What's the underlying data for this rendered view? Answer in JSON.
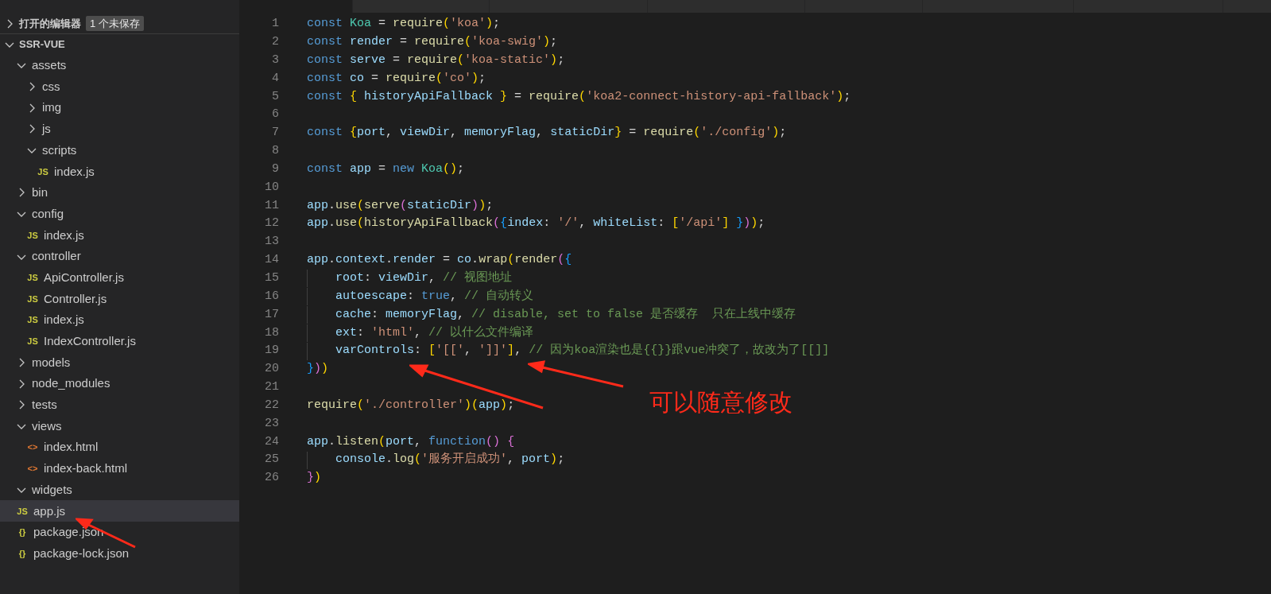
{
  "tabs": [
    {
      "selected": true
    },
    {
      "selected": false
    },
    {
      "selected": false
    },
    {
      "selected": false
    },
    {
      "selected": false
    },
    {
      "selected": false
    },
    {
      "selected": false
    },
    {
      "selected": false
    }
  ],
  "explorer": {
    "open_editors": {
      "label": "打开的编辑器",
      "badge": "1 个未保存",
      "expanded": false
    },
    "root": {
      "label": "SSR-VUE",
      "expanded": true,
      "selected": false,
      "children": [
        {
          "kind": "folder",
          "label": "assets",
          "expanded": true,
          "selected": false,
          "children": [
            {
              "kind": "folder",
              "label": "css",
              "expanded": false,
              "selected": false
            },
            {
              "kind": "folder",
              "label": "img",
              "expanded": false,
              "selected": false
            },
            {
              "kind": "folder",
              "label": "js",
              "expanded": false,
              "selected": false
            },
            {
              "kind": "folder",
              "label": "scripts",
              "expanded": true,
              "selected": false,
              "children": [
                {
                  "kind": "js",
                  "icon": "JS",
                  "label": "index.js",
                  "selected": false
                }
              ]
            }
          ]
        },
        {
          "kind": "folder",
          "label": "bin",
          "expanded": false,
          "selected": false
        },
        {
          "kind": "folder",
          "label": "config",
          "expanded": true,
          "selected": false,
          "children": [
            {
              "kind": "js",
              "icon": "JS",
              "label": "index.js",
              "selected": false
            }
          ]
        },
        {
          "kind": "folder",
          "label": "controller",
          "expanded": true,
          "selected": false,
          "children": [
            {
              "kind": "js",
              "icon": "JS",
              "label": "ApiController.js",
              "selected": false
            },
            {
              "kind": "js",
              "icon": "JS",
              "label": "Controller.js",
              "selected": false
            },
            {
              "kind": "js",
              "icon": "JS",
              "label": "index.js",
              "selected": false
            },
            {
              "kind": "js",
              "icon": "JS",
              "label": "IndexController.js",
              "selected": false
            }
          ]
        },
        {
          "kind": "folder",
          "label": "models",
          "expanded": false,
          "selected": false
        },
        {
          "kind": "folder",
          "label": "node_modules",
          "expanded": false,
          "selected": false
        },
        {
          "kind": "folder",
          "label": "tests",
          "expanded": false,
          "selected": false
        },
        {
          "kind": "folder",
          "label": "views",
          "expanded": true,
          "selected": false,
          "children": [
            {
              "kind": "html",
              "icon": "<>",
              "label": "index.html",
              "selected": false
            },
            {
              "kind": "html",
              "icon": "<>",
              "label": "index-back.html",
              "selected": false
            }
          ]
        },
        {
          "kind": "folder",
          "label": "widgets",
          "expanded": true,
          "selected": false
        },
        {
          "kind": "js",
          "icon": "JS",
          "label": "app.js",
          "selected": true
        },
        {
          "kind": "json",
          "icon": "{}",
          "label": "package.json",
          "selected": false
        },
        {
          "kind": "json",
          "icon": "{}",
          "label": "package-lock.json",
          "selected": false
        }
      ]
    }
  },
  "code": [
    {
      "number": "1",
      "tokens": [
        {
          "kind": "keyword",
          "text": "const "
        },
        {
          "kind": "class",
          "text": "Koa"
        },
        {
          "kind": "plain",
          "text": " = "
        },
        {
          "kind": "function",
          "text": "require"
        },
        {
          "kind": "bracket1",
          "text": "("
        },
        {
          "kind": "string",
          "text": "'koa'"
        },
        {
          "kind": "bracket1",
          "text": ")"
        },
        {
          "kind": "plain",
          "text": ";"
        }
      ]
    },
    {
      "number": "2",
      "tokens": [
        {
          "kind": "keyword",
          "text": "const "
        },
        {
          "kind": "variable",
          "text": "render"
        },
        {
          "kind": "plain",
          "text": " = "
        },
        {
          "kind": "function",
          "text": "require"
        },
        {
          "kind": "bracket1",
          "text": "("
        },
        {
          "kind": "string",
          "text": "'koa-swig'"
        },
        {
          "kind": "bracket1",
          "text": ")"
        },
        {
          "kind": "plain",
          "text": ";"
        }
      ]
    },
    {
      "number": "3",
      "tokens": [
        {
          "kind": "keyword",
          "text": "const "
        },
        {
          "kind": "variable",
          "text": "serve"
        },
        {
          "kind": "plain",
          "text": " = "
        },
        {
          "kind": "function",
          "text": "require"
        },
        {
          "kind": "bracket1",
          "text": "("
        },
        {
          "kind": "string",
          "text": "'koa-static'"
        },
        {
          "kind": "bracket1",
          "text": ")"
        },
        {
          "kind": "plain",
          "text": ";"
        }
      ]
    },
    {
      "number": "4",
      "tokens": [
        {
          "kind": "keyword",
          "text": "const "
        },
        {
          "kind": "variable",
          "text": "co"
        },
        {
          "kind": "plain",
          "text": " = "
        },
        {
          "kind": "function",
          "text": "require"
        },
        {
          "kind": "bracket1",
          "text": "("
        },
        {
          "kind": "string",
          "text": "'co'"
        },
        {
          "kind": "bracket1",
          "text": ")"
        },
        {
          "kind": "plain",
          "text": ";"
        }
      ]
    },
    {
      "number": "5",
      "tokens": [
        {
          "kind": "keyword",
          "text": "const "
        },
        {
          "kind": "bracket1",
          "text": "{"
        },
        {
          "kind": "variable",
          "text": " historyApiFallback "
        },
        {
          "kind": "bracket1",
          "text": "}"
        },
        {
          "kind": "plain",
          "text": " = "
        },
        {
          "kind": "function",
          "text": "require"
        },
        {
          "kind": "bracket1",
          "text": "("
        },
        {
          "kind": "string",
          "text": "'koa2-connect-history-api-fallback'"
        },
        {
          "kind": "bracket1",
          "text": ")"
        },
        {
          "kind": "plain",
          "text": ";"
        }
      ]
    },
    {
      "number": "6"
    },
    {
      "number": "7",
      "tokens": [
        {
          "kind": "keyword",
          "text": "const "
        },
        {
          "kind": "bracket1",
          "text": "{"
        },
        {
          "kind": "variable",
          "text": "port"
        },
        {
          "kind": "plain",
          "text": ", "
        },
        {
          "kind": "variable",
          "text": "viewDir"
        },
        {
          "kind": "plain",
          "text": ", "
        },
        {
          "kind": "variable",
          "text": "memoryFlag"
        },
        {
          "kind": "plain",
          "text": ", "
        },
        {
          "kind": "variable",
          "text": "staticDir"
        },
        {
          "kind": "bracket1",
          "text": "}"
        },
        {
          "kind": "plain",
          "text": " = "
        },
        {
          "kind": "function",
          "text": "require"
        },
        {
          "kind": "bracket1",
          "text": "("
        },
        {
          "kind": "string",
          "text": "'./config'"
        },
        {
          "kind": "bracket1",
          "text": ")"
        },
        {
          "kind": "plain",
          "text": ";"
        }
      ]
    },
    {
      "number": "8"
    },
    {
      "number": "9",
      "tokens": [
        {
          "kind": "keyword",
          "text": "const "
        },
        {
          "kind": "variable",
          "text": "app"
        },
        {
          "kind": "plain",
          "text": " = "
        },
        {
          "kind": "keyword",
          "text": "new "
        },
        {
          "kind": "class",
          "text": "Koa"
        },
        {
          "kind": "bracket1",
          "text": "()"
        },
        {
          "kind": "plain",
          "text": ";"
        }
      ]
    },
    {
      "number": "10"
    },
    {
      "number": "11",
      "tokens": [
        {
          "kind": "variable",
          "text": "app"
        },
        {
          "kind": "plain",
          "text": "."
        },
        {
          "kind": "function",
          "text": "use"
        },
        {
          "kind": "bracket1",
          "text": "("
        },
        {
          "kind": "function",
          "text": "serve"
        },
        {
          "kind": "bracket2",
          "text": "("
        },
        {
          "kind": "variable",
          "text": "staticDir"
        },
        {
          "kind": "bracket2",
          "text": ")"
        },
        {
          "kind": "bracket1",
          "text": ")"
        },
        {
          "kind": "plain",
          "text": ";"
        }
      ]
    },
    {
      "number": "12",
      "tokens": [
        {
          "kind": "variable",
          "text": "app"
        },
        {
          "kind": "plain",
          "text": "."
        },
        {
          "kind": "function",
          "text": "use"
        },
        {
          "kind": "bracket1",
          "text": "("
        },
        {
          "kind": "function",
          "text": "historyApiFallback"
        },
        {
          "kind": "bracket2",
          "text": "("
        },
        {
          "kind": "bracket3",
          "text": "{"
        },
        {
          "kind": "variable",
          "text": "index"
        },
        {
          "kind": "plain",
          "text": ": "
        },
        {
          "kind": "string",
          "text": "'/'"
        },
        {
          "kind": "plain",
          "text": ", "
        },
        {
          "kind": "variable",
          "text": "whiteList"
        },
        {
          "kind": "plain",
          "text": ": "
        },
        {
          "kind": "bracket1",
          "text": "["
        },
        {
          "kind": "string",
          "text": "'/api'"
        },
        {
          "kind": "bracket1",
          "text": "] "
        },
        {
          "kind": "bracket3",
          "text": "}"
        },
        {
          "kind": "bracket2",
          "text": ")"
        },
        {
          "kind": "bracket1",
          "text": ")"
        },
        {
          "kind": "plain",
          "text": ";"
        }
      ]
    },
    {
      "number": "13"
    },
    {
      "number": "14",
      "tokens": [
        {
          "kind": "variable",
          "text": "app"
        },
        {
          "kind": "plain",
          "text": "."
        },
        {
          "kind": "variable",
          "text": "context"
        },
        {
          "kind": "plain",
          "text": "."
        },
        {
          "kind": "variable",
          "text": "render"
        },
        {
          "kind": "plain",
          "text": " = "
        },
        {
          "kind": "variable",
          "text": "co"
        },
        {
          "kind": "plain",
          "text": "."
        },
        {
          "kind": "function",
          "text": "wrap"
        },
        {
          "kind": "bracket1",
          "text": "("
        },
        {
          "kind": "function",
          "text": "render"
        },
        {
          "kind": "bracket2",
          "text": "("
        },
        {
          "kind": "bracket3",
          "text": "{"
        }
      ]
    },
    {
      "number": "15",
      "tokens": [
        {
          "kind": "indent"
        },
        {
          "kind": "variable",
          "text": "root"
        },
        {
          "kind": "plain",
          "text": ": "
        },
        {
          "kind": "variable",
          "text": "viewDir"
        },
        {
          "kind": "plain",
          "text": ", "
        },
        {
          "kind": "comment",
          "text": "// 视图地址"
        }
      ]
    },
    {
      "number": "16",
      "tokens": [
        {
          "kind": "indent"
        },
        {
          "kind": "variable",
          "text": "autoescape"
        },
        {
          "kind": "plain",
          "text": ": "
        },
        {
          "kind": "keyword",
          "text": "true"
        },
        {
          "kind": "plain",
          "text": ", "
        },
        {
          "kind": "comment",
          "text": "// 自动转义"
        }
      ]
    },
    {
      "number": "17",
      "tokens": [
        {
          "kind": "indent"
        },
        {
          "kind": "variable",
          "text": "cache"
        },
        {
          "kind": "plain",
          "text": ": "
        },
        {
          "kind": "variable",
          "text": "memoryFlag"
        },
        {
          "kind": "plain",
          "text": ", "
        },
        {
          "kind": "comment",
          "text": "// disable, set to false 是否缓存  只在上线中缓存"
        }
      ]
    },
    {
      "number": "18",
      "tokens": [
        {
          "kind": "indent"
        },
        {
          "kind": "variable",
          "text": "ext"
        },
        {
          "kind": "plain",
          "text": ": "
        },
        {
          "kind": "string",
          "text": "'html'"
        },
        {
          "kind": "plain",
          "text": ", "
        },
        {
          "kind": "comment",
          "text": "// 以什么文件编译"
        }
      ]
    },
    {
      "number": "19",
      "tokens": [
        {
          "kind": "indent"
        },
        {
          "kind": "variable",
          "text": "varControls"
        },
        {
          "kind": "plain",
          "text": ": "
        },
        {
          "kind": "bracket1",
          "text": "["
        },
        {
          "kind": "string",
          "text": "'[['"
        },
        {
          "kind": "plain",
          "text": ", "
        },
        {
          "kind": "string",
          "text": "']]'"
        },
        {
          "kind": "bracket1",
          "text": "]"
        },
        {
          "kind": "plain",
          "text": ", "
        },
        {
          "kind": "comment",
          "text": "// 因为koa渲染也是{{}}跟vue冲突了，故改为了[[]]"
        }
      ]
    },
    {
      "number": "20",
      "tokens": [
        {
          "kind": "bracket3",
          "text": "}"
        },
        {
          "kind": "bracket2",
          "text": ")"
        },
        {
          "kind": "bracket1",
          "text": ")"
        }
      ]
    },
    {
      "number": "21"
    },
    {
      "number": "22",
      "tokens": [
        {
          "kind": "function",
          "text": "require"
        },
        {
          "kind": "bracket1",
          "text": "("
        },
        {
          "kind": "string",
          "text": "'./controller'"
        },
        {
          "kind": "bracket1",
          "text": ")"
        },
        {
          "kind": "bracket1",
          "text": "("
        },
        {
          "kind": "variable",
          "text": "app"
        },
        {
          "kind": "bracket1",
          "text": ")"
        },
        {
          "kind": "plain",
          "text": ";"
        }
      ]
    },
    {
      "number": "23"
    },
    {
      "number": "24",
      "tokens": [
        {
          "kind": "variable",
          "text": "app"
        },
        {
          "kind": "plain",
          "text": "."
        },
        {
          "kind": "function",
          "text": "listen"
        },
        {
          "kind": "bracket1",
          "text": "("
        },
        {
          "kind": "variable",
          "text": "port"
        },
        {
          "kind": "plain",
          "text": ", "
        },
        {
          "kind": "keyword",
          "text": "function"
        },
        {
          "kind": "bracket2",
          "text": "() "
        },
        {
          "kind": "bracket2",
          "text": "{"
        }
      ]
    },
    {
      "number": "25",
      "tokens": [
        {
          "kind": "indent"
        },
        {
          "kind": "variable",
          "text": "console"
        },
        {
          "kind": "plain",
          "text": "."
        },
        {
          "kind": "function",
          "text": "log"
        },
        {
          "kind": "bracket1",
          "text": "("
        },
        {
          "kind": "string",
          "text": "'服务开启成功'"
        },
        {
          "kind": "plain",
          "text": ", "
        },
        {
          "kind": "variable",
          "text": "port"
        },
        {
          "kind": "bracket1",
          "text": ")"
        },
        {
          "kind": "plain",
          "text": ";"
        }
      ]
    },
    {
      "number": "26",
      "tokens": [
        {
          "kind": "bracket2",
          "text": "}"
        },
        {
          "kind": "bracket1",
          "text": ")"
        }
      ]
    }
  ],
  "annotation": {
    "text": "可以随意修改"
  }
}
